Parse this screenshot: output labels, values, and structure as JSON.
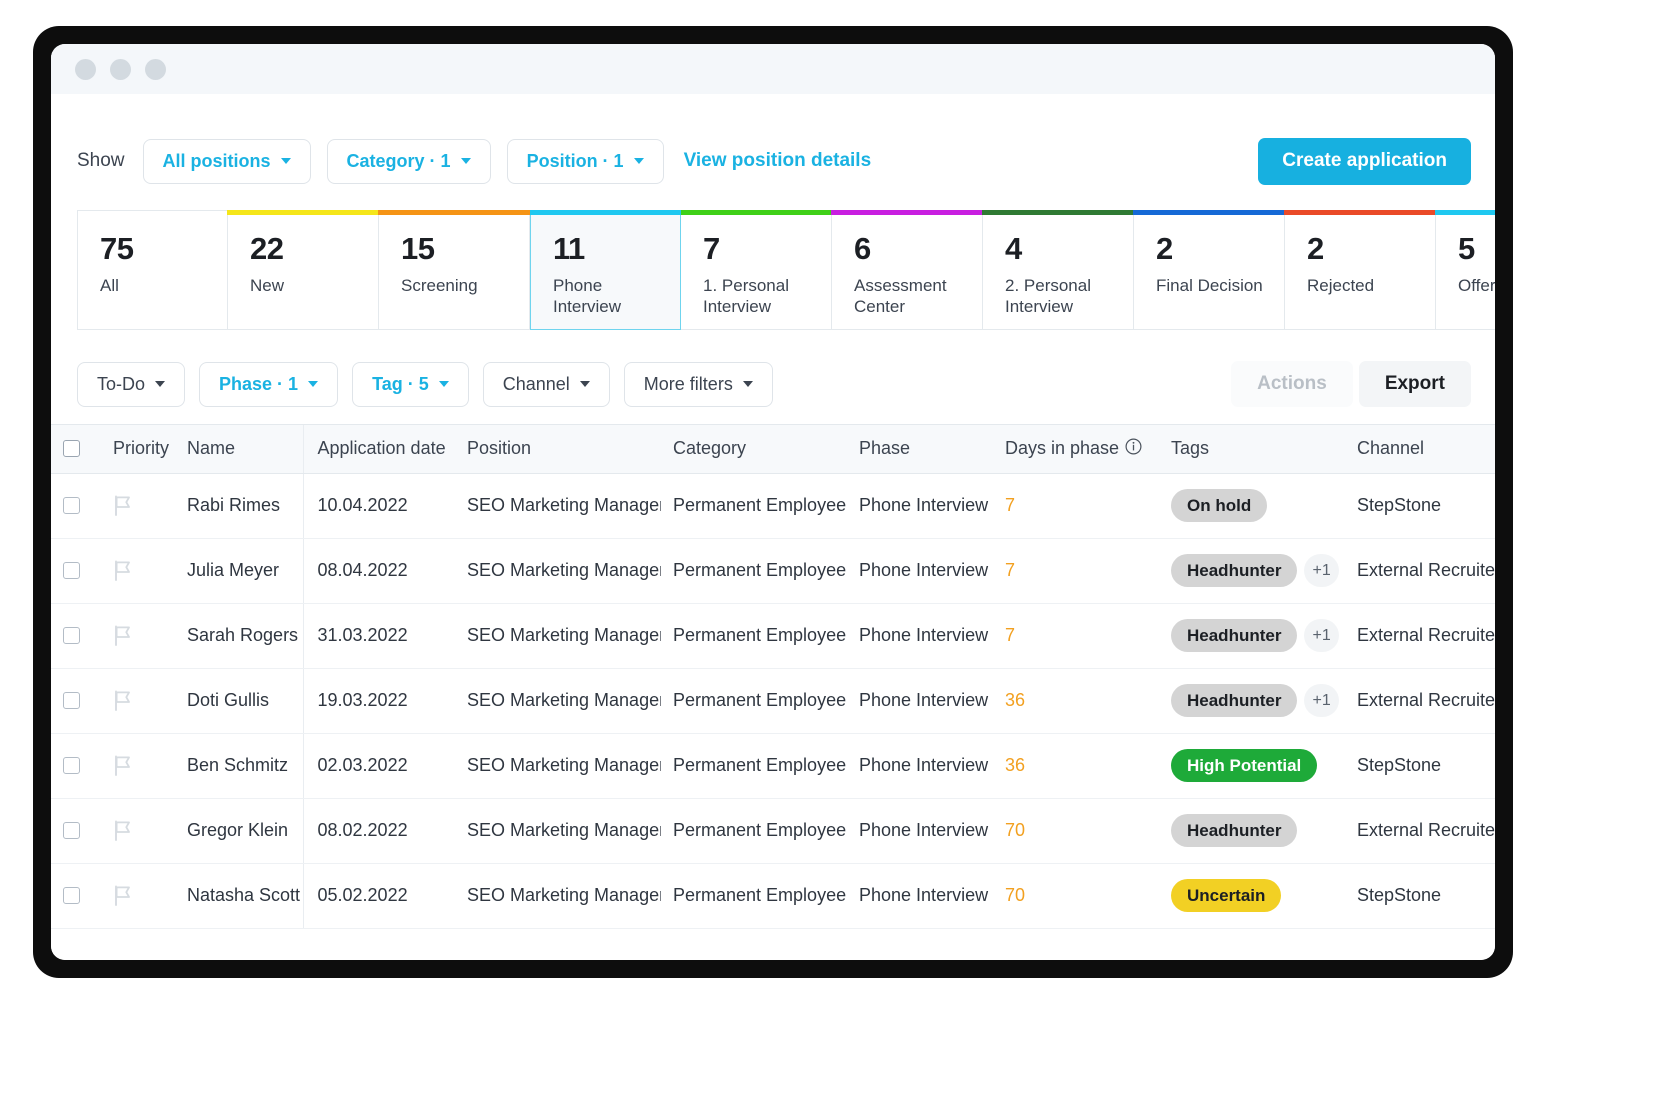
{
  "toolbar": {
    "show_label": "Show",
    "filters": [
      {
        "label": "All positions",
        "active": true
      },
      {
        "label": "Category · 1",
        "active": true
      },
      {
        "label": "Position · 1",
        "active": true
      }
    ],
    "view_details_link": "View position details",
    "create_application_label": "Create application",
    "accent_color": "#17b0e0"
  },
  "stages": [
    {
      "count": "75",
      "name": "All",
      "color": "#ffffff",
      "active": false
    },
    {
      "count": "22",
      "name": "New",
      "color": "#f5e61a",
      "active": false
    },
    {
      "count": "15",
      "name": "Screening",
      "color": "#f59415",
      "active": false
    },
    {
      "count": "11",
      "name": "Phone Interview",
      "color": "#1fc8f0",
      "active": true
    },
    {
      "count": "7",
      "name": "1. Personal Interview",
      "color": "#3fd018",
      "active": false
    },
    {
      "count": "6",
      "name": "Assessment Center",
      "color": "#c81ee0",
      "active": false
    },
    {
      "count": "4",
      "name": "2. Personal Interview",
      "color": "#2f7a33",
      "active": false
    },
    {
      "count": "2",
      "name": "Final Decision",
      "color": "#1569d6",
      "active": false
    },
    {
      "count": "2",
      "name": "Rejected",
      "color": "#ea4a28",
      "active": false
    },
    {
      "count": "5",
      "name": "Offer",
      "color": "#1fc8f0",
      "active": false
    }
  ],
  "filters_row": {
    "filters": [
      {
        "label": "To-Do",
        "active": false
      },
      {
        "label": "Phase · 1",
        "active": true
      },
      {
        "label": "Tag · 5",
        "active": true
      },
      {
        "label": "Channel",
        "active": false
      },
      {
        "label": "More filters",
        "active": false
      }
    ],
    "actions_label": "Actions",
    "export_label": "Export"
  },
  "table": {
    "columns": [
      "Priority",
      "Name",
      "Application date",
      "Position",
      "Category",
      "Phase",
      "Days in phase",
      "Tags",
      "Channel"
    ],
    "rows": [
      {
        "name": "Rabi Rimes",
        "date": "10.04.2022",
        "position": "SEO Marketing Manager",
        "category": "Permanent Employee",
        "phase": "Phone Interview",
        "days": "7",
        "tag": "On hold",
        "tag_style": "grey",
        "tag_more": "",
        "channel": "StepStone"
      },
      {
        "name": "Julia Meyer",
        "date": "08.04.2022",
        "position": "SEO Marketing Manager",
        "category": "Permanent Employee",
        "phase": "Phone Interview",
        "days": "7",
        "tag": "Headhunter",
        "tag_style": "grey",
        "tag_more": "+1",
        "channel": "External Recruiter"
      },
      {
        "name": "Sarah Rogers",
        "date": "31.03.2022",
        "position": "SEO Marketing Manager",
        "category": "Permanent Employee",
        "phase": "Phone Interview",
        "days": "7",
        "tag": "Headhunter",
        "tag_style": "grey",
        "tag_more": "+1",
        "channel": "External Recruiter"
      },
      {
        "name": "Doti Gullis",
        "date": "19.03.2022",
        "position": "SEO Marketing Manager",
        "category": "Permanent Employee",
        "phase": "Phone Interview",
        "days": "36",
        "tag": "Headhunter",
        "tag_style": "grey",
        "tag_more": "+1",
        "channel": "External Recruiter"
      },
      {
        "name": "Ben Schmitz",
        "date": "02.03.2022",
        "position": "SEO Marketing Manager",
        "category": "Permanent Employee",
        "phase": "Phone Interview",
        "days": "36",
        "tag": "High Potential",
        "tag_style": "green",
        "tag_more": "",
        "channel": "StepStone"
      },
      {
        "name": "Gregor Klein",
        "date": "08.02.2022",
        "position": "SEO Marketing Manager",
        "category": "Permanent Employee",
        "phase": "Phone Interview",
        "days": "70",
        "tag": "Headhunter",
        "tag_style": "grey",
        "tag_more": "",
        "channel": "External Recruiter"
      },
      {
        "name": "Natasha Scott",
        "date": "05.02.2022",
        "position": "SEO Marketing Manager",
        "category": "Permanent Employee",
        "phase": "Phone Interview",
        "days": "70",
        "tag": "Uncertain",
        "tag_style": "yellow",
        "tag_more": "",
        "channel": "StepStone"
      }
    ]
  }
}
